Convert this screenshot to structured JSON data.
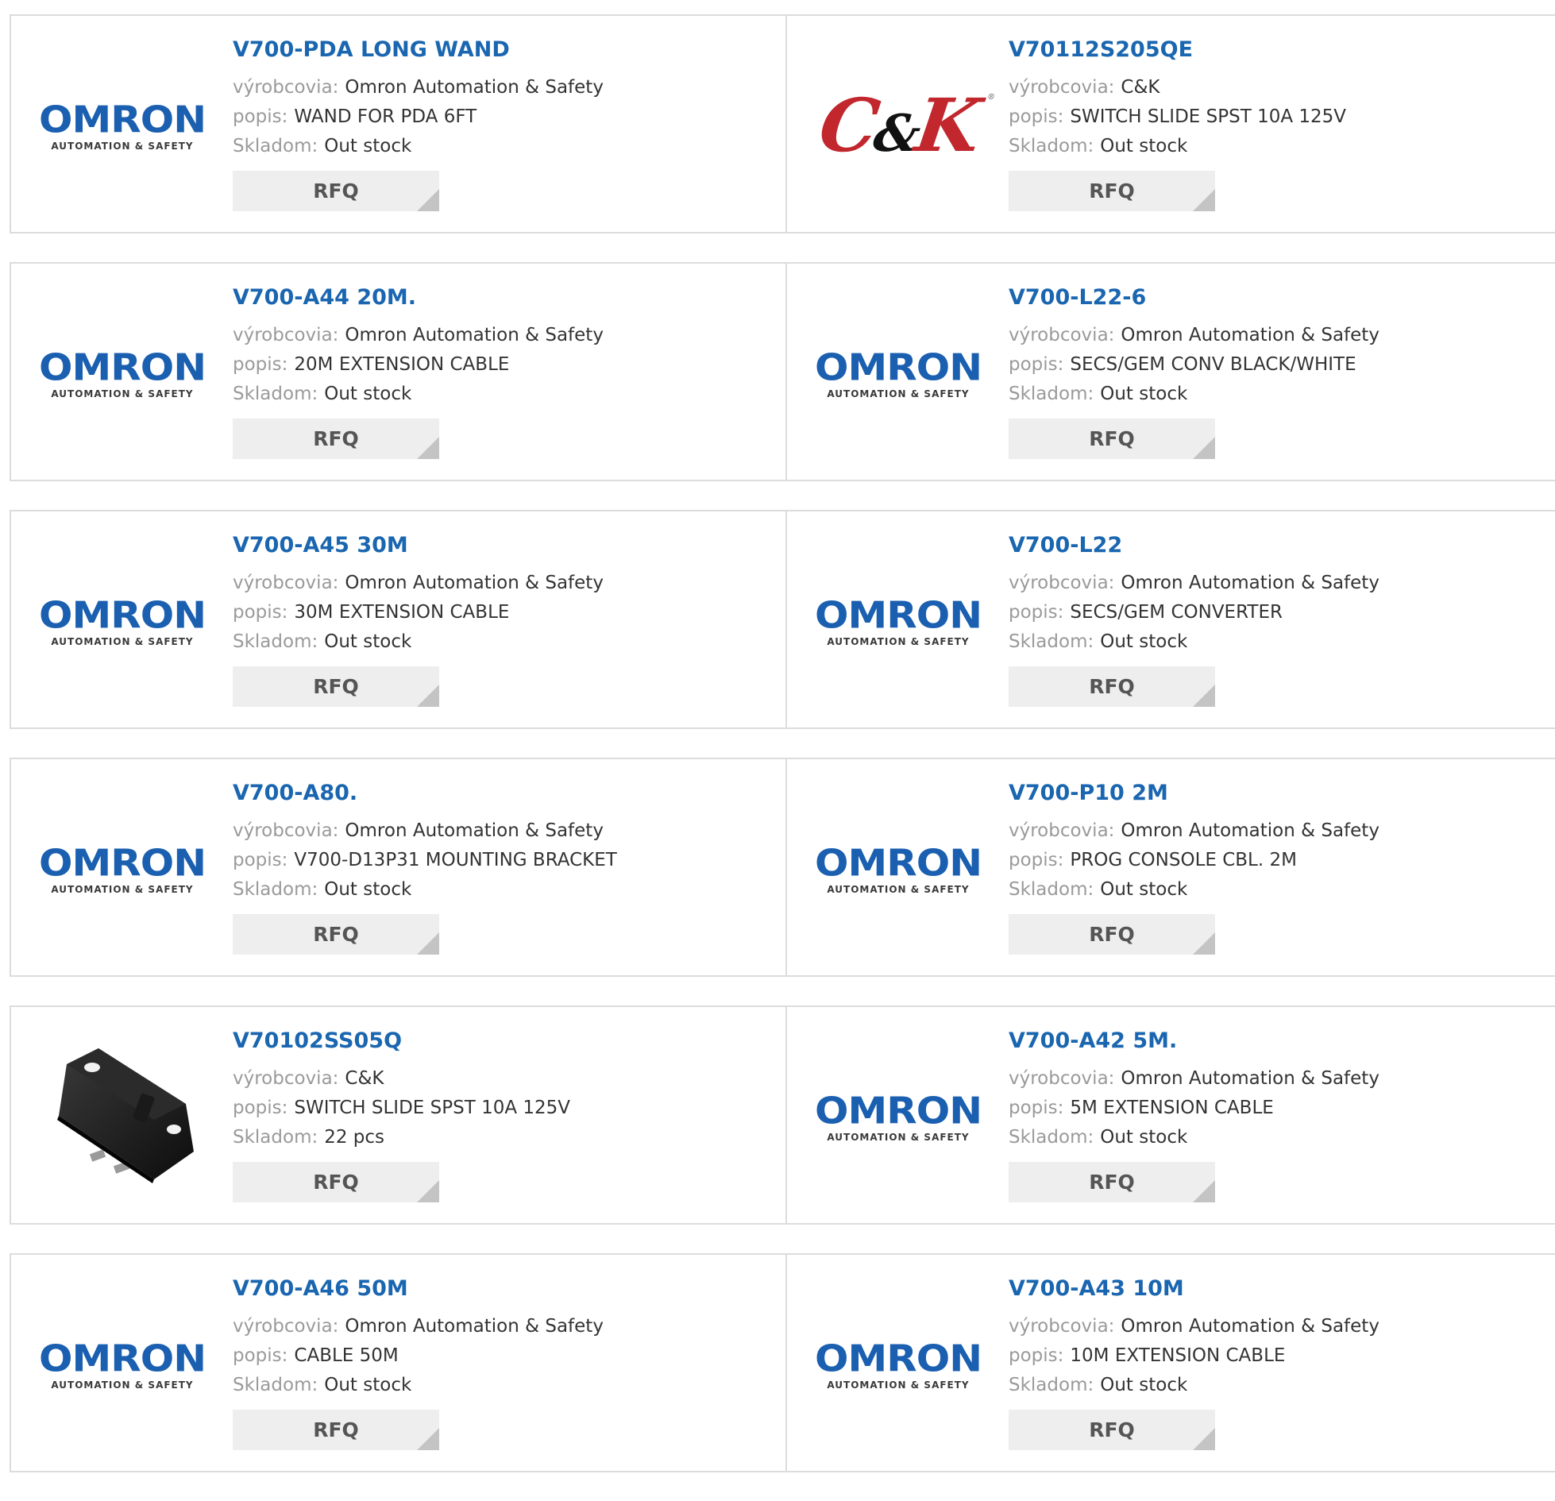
{
  "labels": {
    "manufacturer": "výrobcovia:",
    "description": "popis:",
    "stock": "Skladom:",
    "rfq": "RFQ"
  },
  "logos": {
    "omron_word": "OMRON",
    "omron_sub": "AUTOMATION & SAFETY",
    "ck_c": "C",
    "ck_amp": "&",
    "ck_k": "K",
    "ck_mark": "®"
  },
  "colors": {
    "part_link": "#1a66b0",
    "label": "#9a9a9a",
    "omron_blue": "#1a5fb0",
    "ck_red": "#c1272d",
    "rfq_bg": "#eeeeee"
  },
  "products": [
    {
      "part": "V700-PDA LONG WAND",
      "logo": "omron",
      "manufacturer": "Omron Automation & Safety",
      "description": "WAND FOR PDA 6FT",
      "stock": "Out stock"
    },
    {
      "part": "V70112S205QE",
      "logo": "ck",
      "manufacturer": "C&K",
      "description": "SWITCH SLIDE SPST 10A 125V",
      "stock": "Out stock"
    },
    {
      "part": "V700-A44 20M.",
      "logo": "omron",
      "manufacturer": "Omron Automation & Safety",
      "description": "20M EXTENSION CABLE",
      "stock": "Out stock"
    },
    {
      "part": "V700-L22-6",
      "logo": "omron",
      "manufacturer": "Omron Automation & Safety",
      "description": "SECS/GEM CONV BLACK/WHITE",
      "stock": "Out stock"
    },
    {
      "part": "V700-A45 30M",
      "logo": "omron",
      "manufacturer": "Omron Automation & Safety",
      "description": "30M EXTENSION CABLE",
      "stock": "Out stock"
    },
    {
      "part": "V700-L22",
      "logo": "omron",
      "manufacturer": "Omron Automation & Safety",
      "description": "SECS/GEM CONVERTER",
      "stock": "Out stock"
    },
    {
      "part": "V700-A80.",
      "logo": "omron",
      "manufacturer": "Omron Automation & Safety",
      "description": "V700-D13P31 MOUNTING BRACKET",
      "stock": "Out stock"
    },
    {
      "part": "V700-P10 2M",
      "logo": "omron",
      "manufacturer": "Omron Automation & Safety",
      "description": "PROG CONSOLE CBL. 2M",
      "stock": "Out stock"
    },
    {
      "part": "V70102SS05Q",
      "logo": "switch-photo",
      "manufacturer": "C&K",
      "description": "SWITCH SLIDE SPST 10A 125V",
      "stock": "22 pcs"
    },
    {
      "part": "V700-A42 5M.",
      "logo": "omron",
      "manufacturer": "Omron Automation & Safety",
      "description": "5M EXTENSION CABLE",
      "stock": "Out stock"
    },
    {
      "part": "V700-A46 50M",
      "logo": "omron",
      "manufacturer": "Omron Automation & Safety",
      "description": "CABLE 50M",
      "stock": "Out stock"
    },
    {
      "part": "V700-A43 10M",
      "logo": "omron",
      "manufacturer": "Omron Automation & Safety",
      "description": "10M EXTENSION CABLE",
      "stock": "Out stock"
    }
  ]
}
